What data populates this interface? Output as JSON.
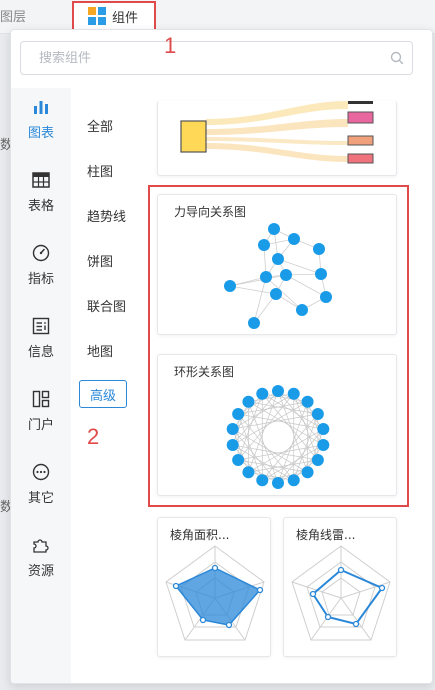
{
  "tabs": {
    "layers": "图层",
    "components": "组件"
  },
  "annotations": {
    "first": "1",
    "second": "2"
  },
  "peek_text": {
    "top": "数",
    "bottom": "数"
  },
  "search": {
    "placeholder": "搜索组件"
  },
  "rail": [
    {
      "label": "图表",
      "icon": "bar-chart-icon",
      "active": true
    },
    {
      "label": "表格",
      "icon": "table-icon",
      "active": false
    },
    {
      "label": "指标",
      "icon": "gauge-icon",
      "active": false
    },
    {
      "label": "信息",
      "icon": "info-card-icon",
      "active": false
    },
    {
      "label": "门户",
      "icon": "portal-layout-icon",
      "active": false
    },
    {
      "label": "其它",
      "icon": "more-dots-icon",
      "active": false
    },
    {
      "label": "资源",
      "icon": "puzzle-icon",
      "active": false
    }
  ],
  "categories": [
    {
      "label": "全部",
      "active": false
    },
    {
      "label": "柱图",
      "active": false
    },
    {
      "label": "趋势线",
      "active": false
    },
    {
      "label": "饼图",
      "active": false
    },
    {
      "label": "联合图",
      "active": false
    },
    {
      "label": "地图",
      "active": false
    },
    {
      "label": "高级",
      "active": true
    }
  ],
  "cards": {
    "force": {
      "title": "力导向关系图"
    },
    "ring": {
      "title": "环形关系图"
    },
    "radar_area": {
      "title": "棱角面积..."
    },
    "radar_line": {
      "title": "棱角线雷..."
    }
  },
  "colors": {
    "accent": "#2b88d8",
    "node": "#1a9be8",
    "highlight": "#e04a4a",
    "sankey_source": "#ffd857",
    "sankey_pink": "#e8679e",
    "sankey_orange": "#f0a07a",
    "sankey_red": "#f0727c"
  }
}
